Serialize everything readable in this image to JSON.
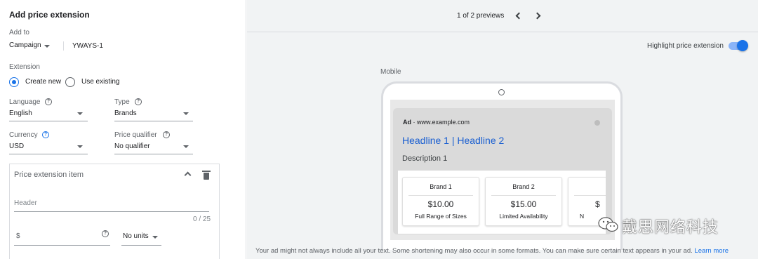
{
  "panel": {
    "title": "Add price extension",
    "add_to_label": "Add to",
    "add_to_value": "Campaign",
    "campaign_name": "YWAYS-1",
    "extension_label": "Extension",
    "create_new": "Create new",
    "use_existing": "Use existing",
    "language_label": "Language",
    "language_value": "English",
    "type_label": "Type",
    "type_value": "Brands",
    "currency_label": "Currency",
    "currency_value": "USD",
    "qualifier_label": "Price qualifier",
    "qualifier_value": "No qualifier",
    "item_title": "Price extension item",
    "header_placeholder": "Header",
    "header_counter": "0 / 25",
    "price_prefix": "$",
    "units_value": "No units"
  },
  "preview": {
    "count_text": "1 of 2 previews",
    "highlight_label": "Highlight price extension",
    "highlight_on": true,
    "device_label": "Mobile",
    "ad_badge": "Ad",
    "ad_url": "· www.example.com",
    "headline": "Headline 1 | Headline 2",
    "description": "Description 1",
    "items": [
      {
        "name": "Brand 1",
        "price": "$10.00",
        "desc": "Full Range of Sizes"
      },
      {
        "name": "Brand 2",
        "price": "$15.00",
        "desc": "Limited Availability"
      },
      {
        "name": "",
        "price": "$",
        "desc": "N"
      }
    ],
    "footer_text": "Your ad might not always include all your text. Some shortening may also occur in some formats. You can make sure certain text appears in your ad.",
    "learn_more": "Learn more"
  },
  "watermark": {
    "text": "戴思网络科技"
  },
  "colors": {
    "accent": "#1a73e8",
    "headline": "#1a5fd1",
    "toggle_track": "#8ab4f8"
  },
  "icons": [
    "chevron-down-icon",
    "help-icon",
    "chevron-up-icon",
    "trash-icon",
    "chevron-left-icon",
    "chevron-right-icon",
    "wechat-icon"
  ]
}
